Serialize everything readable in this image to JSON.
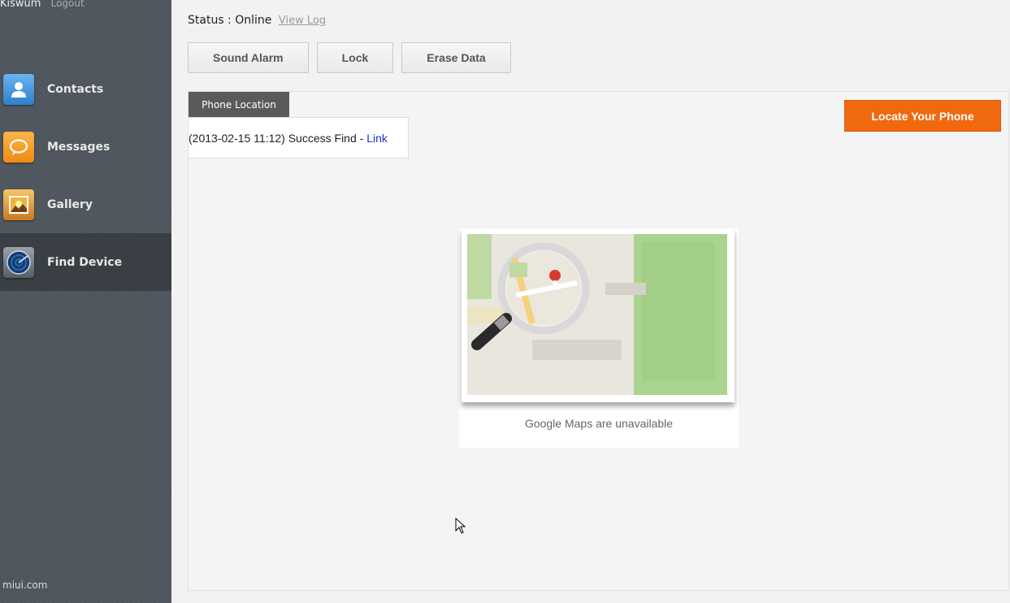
{
  "user": {
    "name": "Kiswum",
    "logout_label": "Logout"
  },
  "nav": [
    {
      "label": "Contacts",
      "icon": "contacts-icon"
    },
    {
      "label": "Messages",
      "icon": "chat-bubble-icon"
    },
    {
      "label": "Gallery",
      "icon": "picture-icon"
    },
    {
      "label": "Find Device",
      "icon": "radar-icon",
      "active": true
    }
  ],
  "footer": {
    "brand": "miui.com"
  },
  "device": {
    "status_label": "Status : ",
    "status_value": "Online",
    "view_log_label": "View Log"
  },
  "actions": {
    "sound_alarm": "Sound Alarm",
    "lock": "Lock",
    "erase_data": "Erase Data"
  },
  "location": {
    "tab_label": "Phone Location",
    "find_text": "(2013-02-15 11:12) Success Find - ",
    "link_label": "Link",
    "locate_button": "Locate Your Phone",
    "map_caption": "Google Maps are unavailable"
  },
  "colors": {
    "accent": "#f1690f",
    "sidebar": "#4d545b",
    "link": "#1a34d4"
  }
}
